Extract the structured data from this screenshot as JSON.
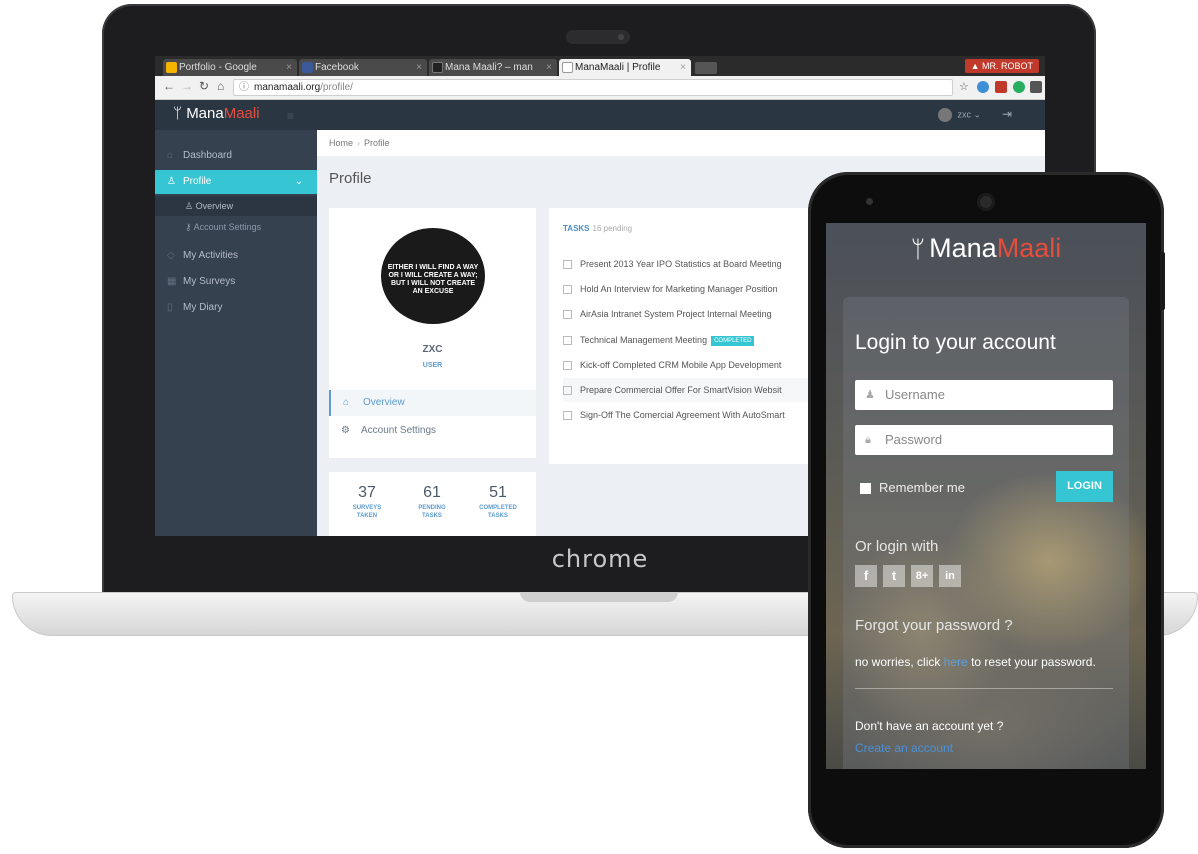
{
  "laptop": {
    "brand": "chrome",
    "browser": {
      "tabs": [
        {
          "label": "Portfolio - Google",
          "favicon_color": "#f4b400"
        },
        {
          "label": "Facebook",
          "favicon_color": "#3b5998"
        },
        {
          "label": "Mana Maali? – man",
          "favicon_color": "#222222"
        },
        {
          "label": "ManaMaali | Profile",
          "favicon_color": "#888888"
        }
      ],
      "profile_badge": "▲ MR. ROBOT",
      "url_host": "manamaali.org",
      "url_path": "/profile/"
    },
    "app": {
      "logo_part1": "Mana",
      "logo_part2": "Maali",
      "user_name": "zxc ⌄",
      "sidebar": [
        {
          "label": "Dashboard",
          "icon": "home-icon"
        },
        {
          "label": "Profile",
          "icon": "user-icon"
        },
        {
          "label": "Overview",
          "icon": "user-icon"
        },
        {
          "label": "Account Settings",
          "icon": "key-icon"
        },
        {
          "label": "My Activities",
          "icon": "tag-icon"
        },
        {
          "label": "My Surveys",
          "icon": "grid-icon"
        },
        {
          "label": "My Diary",
          "icon": "book-icon"
        }
      ],
      "breadcrumb": {
        "home": "Home",
        "current": "Profile"
      },
      "page_title": "Profile",
      "profile": {
        "avatar_quote": "EITHER I WILL FIND A WAY OR I WILL CREATE A WAY; BUT I WILL NOT CREATE AN EXCUSE",
        "name": "ZXC",
        "role": "USER",
        "menu": [
          {
            "label": "Overview",
            "icon": "home-icon"
          },
          {
            "label": "Account Settings",
            "icon": "gear-icon"
          }
        ]
      },
      "stats": [
        {
          "value": "37",
          "label_1": "SURVEYS",
          "label_2": "TAKEN"
        },
        {
          "value": "61",
          "label_1": "PENDING",
          "label_2": "TASKS"
        },
        {
          "value": "51",
          "label_1": "COMPLETED",
          "label_2": "TASKS"
        }
      ],
      "tasks": {
        "title": "TASKS",
        "pending": "16 pending",
        "items": [
          {
            "label": "Present 2013 Year IPO Statistics at Board Meeting",
            "badge": ""
          },
          {
            "label": "Hold An Interview for Marketing Manager Position",
            "badge": ""
          },
          {
            "label": "AirAsia Intranet System Project Internal Meeting",
            "badge": ""
          },
          {
            "label": "Technical Management Meeting",
            "badge": "COMPLETED"
          },
          {
            "label": "Kick-off Completed CRM Mobile App Development",
            "badge": ""
          },
          {
            "label": "Prepare Commercial Offer For SmartVision Websit",
            "badge": ""
          },
          {
            "label": "Sign-Off The Comercial Agreement With AutoSmart",
            "badge": ""
          }
        ]
      }
    }
  },
  "phone": {
    "logo_part1": "Mana",
    "logo_part2": "Maali",
    "title": "Login to your account",
    "username_placeholder": "Username",
    "password_placeholder": "Password",
    "remember": "Remember me",
    "login_button": "LOGIN",
    "or_login": "Or login with",
    "social": [
      "f",
      "t",
      "8+",
      "in"
    ],
    "forgot_title": "Forgot your password ?",
    "reset_prefix": "no worries, click",
    "reset_link": "here",
    "reset_suffix": "to reset your password.",
    "no_account": "Don't have an account yet ?",
    "create_account": "Create an account",
    "accent_color": "#36c6d3"
  }
}
